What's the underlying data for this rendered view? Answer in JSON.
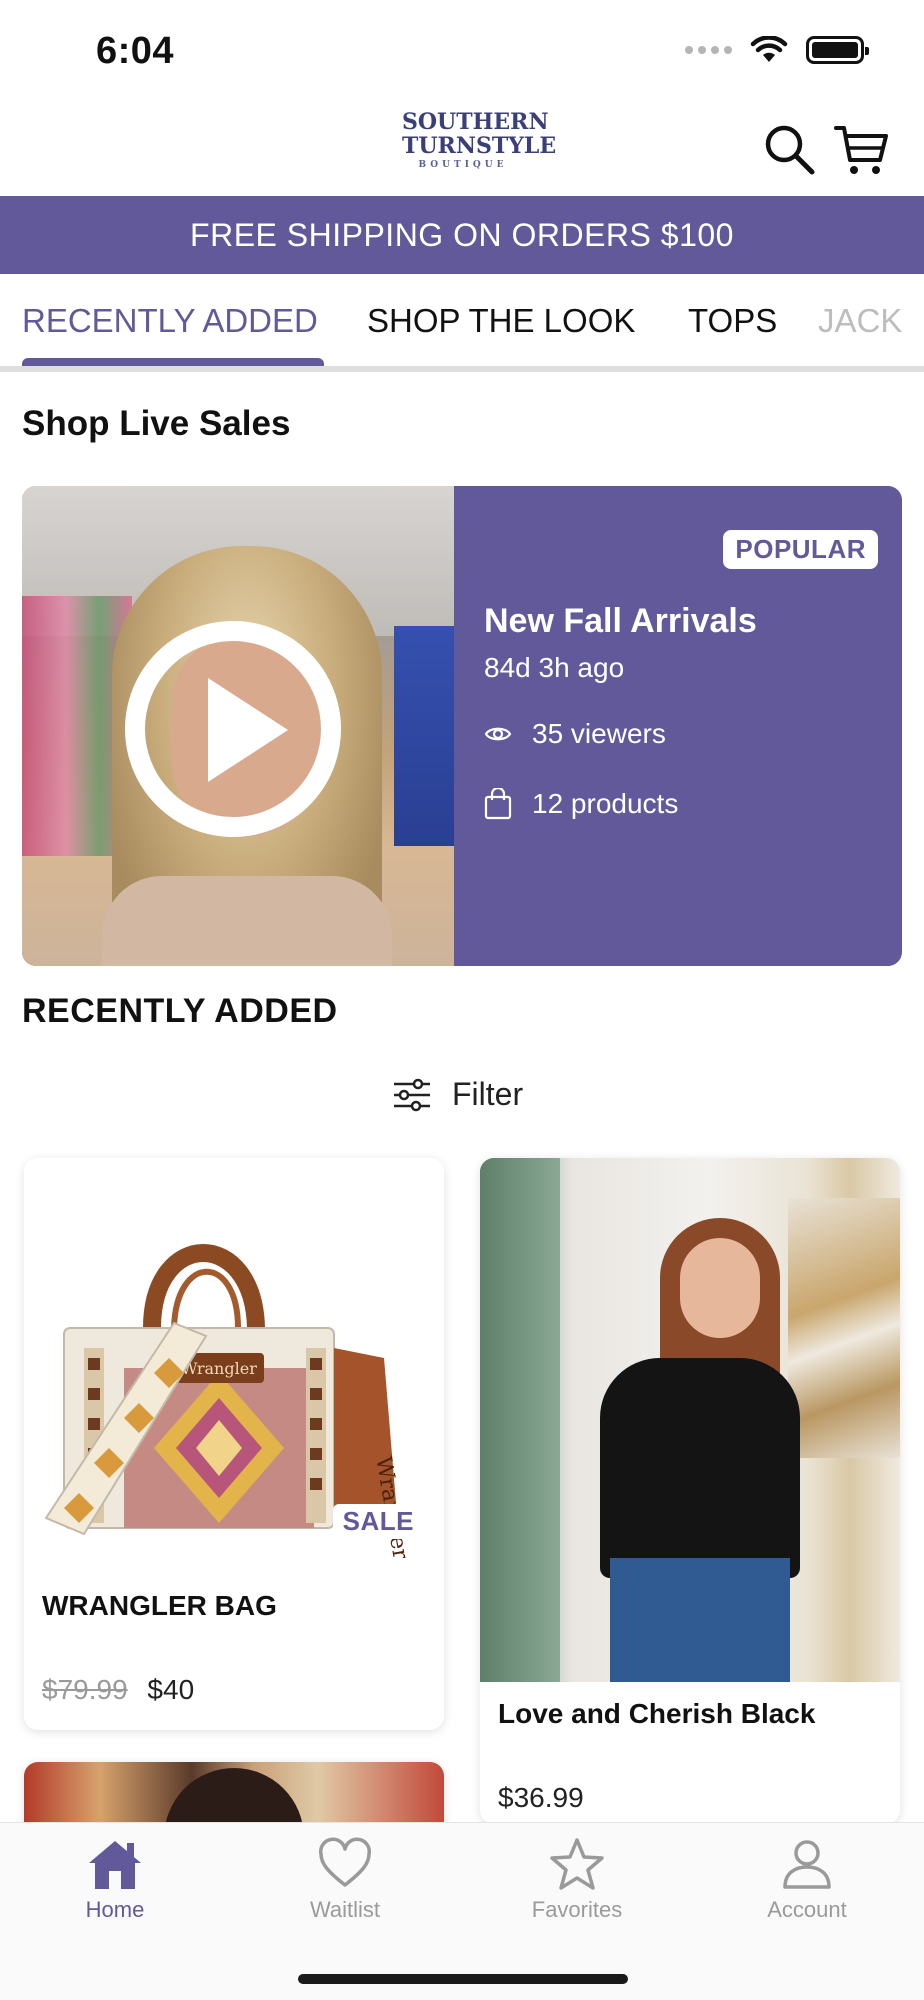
{
  "status_bar": {
    "time": "6:04"
  },
  "header": {
    "logo": {
      "line1": "SOUTHERN",
      "line2": "TURNSTYLE",
      "line3": "BOUTIQUE"
    }
  },
  "banner": {
    "text": "FREE SHIPPING ON ORDERS $100"
  },
  "tabs": [
    {
      "label": "RECENTLY ADDED",
      "active": true
    },
    {
      "label": "SHOP THE LOOK",
      "active": false
    },
    {
      "label": "TOPS",
      "active": false
    },
    {
      "label": "JACK",
      "active": false
    }
  ],
  "live_sales": {
    "section_title": "Shop Live Sales",
    "card": {
      "badge": "POPULAR",
      "title": "New Fall Arrivals",
      "ago": "84d 3h ago",
      "viewers": "35 viewers",
      "products": "12 products"
    }
  },
  "recently_added": {
    "section_title": "RECENTLY ADDED",
    "filter_label": "Filter",
    "products": [
      {
        "name": "WRANGLER BAG",
        "old_price": "$79.99",
        "price": "$40",
        "badge": "SALE"
      },
      {
        "name": "Love and Cherish Black",
        "price": "$36.99"
      }
    ]
  },
  "tab_bar": {
    "items": [
      {
        "label": "Home",
        "icon": "home-icon",
        "active": true
      },
      {
        "label": "Waitlist",
        "icon": "heart-icon",
        "active": false
      },
      {
        "label": "Favorites",
        "icon": "star-icon",
        "active": false
      },
      {
        "label": "Account",
        "icon": "person-icon",
        "active": false
      }
    ]
  },
  "colors": {
    "accent": "#62599a",
    "banner_bg": "#62599a",
    "inactive": "#9a9a9a"
  }
}
